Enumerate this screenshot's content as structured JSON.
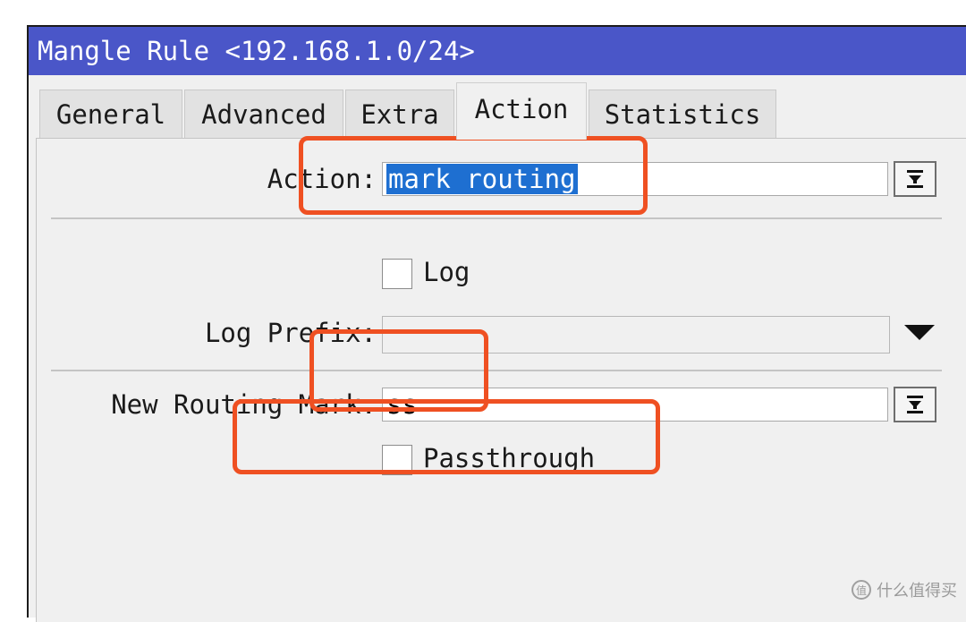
{
  "window": {
    "title": "Mangle Rule <192.168.1.0/24>"
  },
  "tabs": [
    {
      "label": "General"
    },
    {
      "label": "Advanced"
    },
    {
      "label": "Extra"
    },
    {
      "label": "Action"
    },
    {
      "label": "Statistics"
    }
  ],
  "active_tab": "Action",
  "form": {
    "action": {
      "label": "Action:",
      "value": "mark routing"
    },
    "log": {
      "label": "Log",
      "checked": false
    },
    "log_prefix": {
      "label": "Log Prefix:",
      "value": ""
    },
    "new_routing_mark": {
      "label": "New Routing Mark:",
      "value": "ss"
    },
    "passthrough": {
      "label": "Passthrough",
      "checked": false
    }
  },
  "icons": {
    "dropdown_button": "down-arrow-to-bar-icon",
    "combo_arrow": "triangle-down-icon"
  },
  "colors": {
    "titlebar": "#4a56c8",
    "selection": "#1e6fd1",
    "annotation": "#ef5022"
  },
  "watermark": {
    "text": "什么值得买",
    "logo": "值"
  }
}
